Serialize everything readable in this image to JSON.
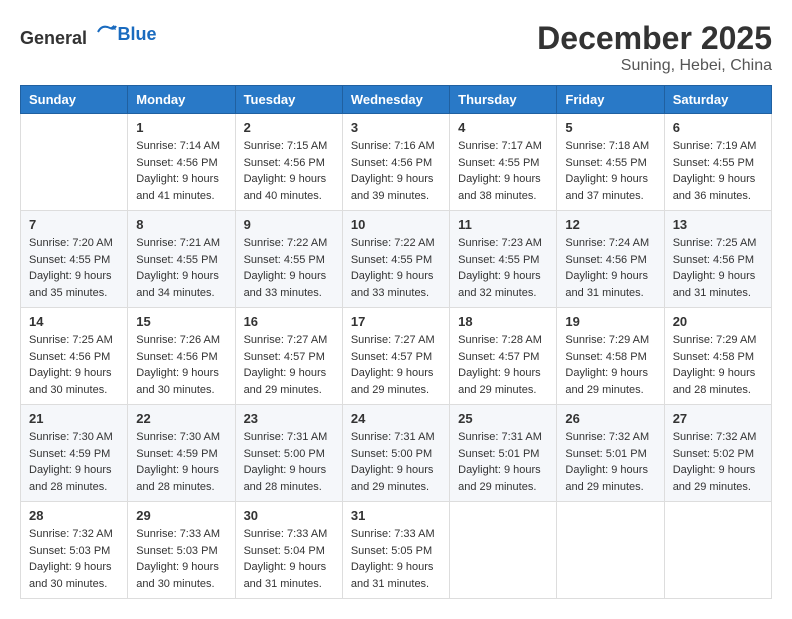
{
  "logo": {
    "general": "General",
    "blue": "Blue"
  },
  "title": "December 2025",
  "location": "Suning, Hebei, China",
  "days_of_week": [
    "Sunday",
    "Monday",
    "Tuesday",
    "Wednesday",
    "Thursday",
    "Friday",
    "Saturday"
  ],
  "weeks": [
    [
      {
        "day": "",
        "info": ""
      },
      {
        "day": "1",
        "info": "Sunrise: 7:14 AM\nSunset: 4:56 PM\nDaylight: 9 hours\nand 41 minutes."
      },
      {
        "day": "2",
        "info": "Sunrise: 7:15 AM\nSunset: 4:56 PM\nDaylight: 9 hours\nand 40 minutes."
      },
      {
        "day": "3",
        "info": "Sunrise: 7:16 AM\nSunset: 4:56 PM\nDaylight: 9 hours\nand 39 minutes."
      },
      {
        "day": "4",
        "info": "Sunrise: 7:17 AM\nSunset: 4:55 PM\nDaylight: 9 hours\nand 38 minutes."
      },
      {
        "day": "5",
        "info": "Sunrise: 7:18 AM\nSunset: 4:55 PM\nDaylight: 9 hours\nand 37 minutes."
      },
      {
        "day": "6",
        "info": "Sunrise: 7:19 AM\nSunset: 4:55 PM\nDaylight: 9 hours\nand 36 minutes."
      }
    ],
    [
      {
        "day": "7",
        "info": "Sunrise: 7:20 AM\nSunset: 4:55 PM\nDaylight: 9 hours\nand 35 minutes."
      },
      {
        "day": "8",
        "info": "Sunrise: 7:21 AM\nSunset: 4:55 PM\nDaylight: 9 hours\nand 34 minutes."
      },
      {
        "day": "9",
        "info": "Sunrise: 7:22 AM\nSunset: 4:55 PM\nDaylight: 9 hours\nand 33 minutes."
      },
      {
        "day": "10",
        "info": "Sunrise: 7:22 AM\nSunset: 4:55 PM\nDaylight: 9 hours\nand 33 minutes."
      },
      {
        "day": "11",
        "info": "Sunrise: 7:23 AM\nSunset: 4:55 PM\nDaylight: 9 hours\nand 32 minutes."
      },
      {
        "day": "12",
        "info": "Sunrise: 7:24 AM\nSunset: 4:56 PM\nDaylight: 9 hours\nand 31 minutes."
      },
      {
        "day": "13",
        "info": "Sunrise: 7:25 AM\nSunset: 4:56 PM\nDaylight: 9 hours\nand 31 minutes."
      }
    ],
    [
      {
        "day": "14",
        "info": "Sunrise: 7:25 AM\nSunset: 4:56 PM\nDaylight: 9 hours\nand 30 minutes."
      },
      {
        "day": "15",
        "info": "Sunrise: 7:26 AM\nSunset: 4:56 PM\nDaylight: 9 hours\nand 30 minutes."
      },
      {
        "day": "16",
        "info": "Sunrise: 7:27 AM\nSunset: 4:57 PM\nDaylight: 9 hours\nand 29 minutes."
      },
      {
        "day": "17",
        "info": "Sunrise: 7:27 AM\nSunset: 4:57 PM\nDaylight: 9 hours\nand 29 minutes."
      },
      {
        "day": "18",
        "info": "Sunrise: 7:28 AM\nSunset: 4:57 PM\nDaylight: 9 hours\nand 29 minutes."
      },
      {
        "day": "19",
        "info": "Sunrise: 7:29 AM\nSunset: 4:58 PM\nDaylight: 9 hours\nand 29 minutes."
      },
      {
        "day": "20",
        "info": "Sunrise: 7:29 AM\nSunset: 4:58 PM\nDaylight: 9 hours\nand 28 minutes."
      }
    ],
    [
      {
        "day": "21",
        "info": "Sunrise: 7:30 AM\nSunset: 4:59 PM\nDaylight: 9 hours\nand 28 minutes."
      },
      {
        "day": "22",
        "info": "Sunrise: 7:30 AM\nSunset: 4:59 PM\nDaylight: 9 hours\nand 28 minutes."
      },
      {
        "day": "23",
        "info": "Sunrise: 7:31 AM\nSunset: 5:00 PM\nDaylight: 9 hours\nand 28 minutes."
      },
      {
        "day": "24",
        "info": "Sunrise: 7:31 AM\nSunset: 5:00 PM\nDaylight: 9 hours\nand 29 minutes."
      },
      {
        "day": "25",
        "info": "Sunrise: 7:31 AM\nSunset: 5:01 PM\nDaylight: 9 hours\nand 29 minutes."
      },
      {
        "day": "26",
        "info": "Sunrise: 7:32 AM\nSunset: 5:01 PM\nDaylight: 9 hours\nand 29 minutes."
      },
      {
        "day": "27",
        "info": "Sunrise: 7:32 AM\nSunset: 5:02 PM\nDaylight: 9 hours\nand 29 minutes."
      }
    ],
    [
      {
        "day": "28",
        "info": "Sunrise: 7:32 AM\nSunset: 5:03 PM\nDaylight: 9 hours\nand 30 minutes."
      },
      {
        "day": "29",
        "info": "Sunrise: 7:33 AM\nSunset: 5:03 PM\nDaylight: 9 hours\nand 30 minutes."
      },
      {
        "day": "30",
        "info": "Sunrise: 7:33 AM\nSunset: 5:04 PM\nDaylight: 9 hours\nand 31 minutes."
      },
      {
        "day": "31",
        "info": "Sunrise: 7:33 AM\nSunset: 5:05 PM\nDaylight: 9 hours\nand 31 minutes."
      },
      {
        "day": "",
        "info": ""
      },
      {
        "day": "",
        "info": ""
      },
      {
        "day": "",
        "info": ""
      }
    ]
  ]
}
